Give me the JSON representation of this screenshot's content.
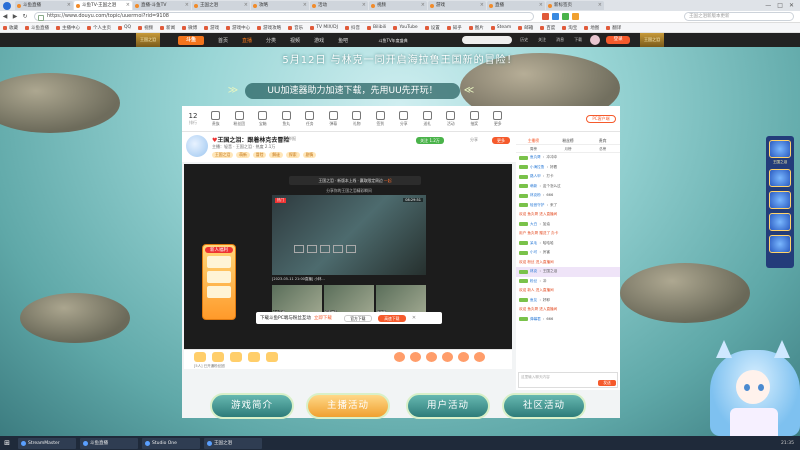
{
  "browser": {
    "tabs": [
      {
        "label": "斗鱼直播",
        "active": false
      },
      {
        "label": "斗鱼TV-王国之泪",
        "active": true
      },
      {
        "label": "直播-斗鱼TV",
        "active": false
      },
      {
        "label": "王国之泪",
        "active": false
      },
      {
        "label": "攻略",
        "active": false
      },
      {
        "label": "活动",
        "active": false
      },
      {
        "label": "视频",
        "active": false
      },
      {
        "label": "游戏",
        "active": false
      },
      {
        "label": "直播",
        "active": false
      },
      {
        "label": "新标签页",
        "active": false
      }
    ],
    "url": "https://www.douyu.com/topic/uuerrnoi?rid=9108",
    "search_placeholder": "王国之泪新版本更新",
    "bookmarks": [
      "收藏",
      "斗鱼直播",
      "主播中心",
      "个人主页",
      "QQ",
      "视频",
      "新闻",
      "微博",
      "游戏",
      "游戏中心",
      "游戏攻略",
      "音乐",
      "TV MIX/DJ",
      "抖音",
      "Bilibili",
      "YouTube",
      "设置",
      "知乎",
      "图片",
      "Steam",
      "邮箱",
      "百度",
      "淘宝",
      "地图",
      "翻译"
    ],
    "window_controls": [
      "—",
      "□",
      "✕"
    ]
  },
  "site": {
    "logo": "斗鱼",
    "nav": [
      "首页",
      "直播",
      "分类",
      "视频",
      "游戏",
      "鱼吧"
    ],
    "header_center": "斗鱼TV年度盛典",
    "header_icons": [
      "历史",
      "关注",
      "消息",
      "下载"
    ],
    "login": "登录",
    "side_badge": "王国之泪",
    "banner_title": "5月12日 与林克一同开启海拉鲁王国新的冒险！",
    "banner_sub": "UU加速器助力加速下载，先用UU先开玩！",
    "banner_arrow_left": "≫",
    "banner_arrow_right": "≪"
  },
  "room": {
    "rank_num": "12",
    "rank_label": "排行",
    "tools": [
      "贵族",
      "粉丝团",
      "宝箱",
      "鱼丸",
      "任务",
      "弹幕",
      "礼物",
      "签到",
      "分享",
      "送礼",
      "活动",
      "抽奖",
      "更多"
    ],
    "pc_button": "PC客户端",
    "title": "王国之泪：跟着林克去冒险",
    "report": "举报",
    "meta": "主播：轻音 · 王国之泪 · 热度 2.1万",
    "tags": [
      "王国之泪",
      "萌新",
      "冒险",
      "解谜",
      "探索",
      "剧情"
    ],
    "follow": "关注 1.2万",
    "share": "分享",
    "more": "更多"
  },
  "player": {
    "event_bar": "王国之泪 · 新版本上线 · 赢取限定周边",
    "event_highlight": "一起",
    "sub_title": "分享你的王国之泪精彩瞬间",
    "video_tag": "热门",
    "video_time": "08:29:51",
    "video_caption": "[2023-05-11 21:00直播] 小林...",
    "thumbs": [
      "左右互搏",
      "探索神庙",
      "新技能"
    ],
    "promo_header": "新人福利",
    "download_text": "下载斗鱼PC端与粉丝互动",
    "download_link": "立即下载",
    "download_btn1": "官方下载",
    "download_btn2": "高速下载",
    "close": "✕",
    "gift_note": "[5人] 已开通粉丝团"
  },
  "chat": {
    "tabs": [
      "主播榜",
      "粉丝榜",
      "贵宾"
    ],
    "active_tab": 0,
    "sub_tabs": [
      "周榜",
      "月榜",
      "总榜"
    ],
    "messages": [
      {
        "lv": "LV8",
        "name": "鱼丸哥",
        "text": "：冲冲冲",
        "type": "normal"
      },
      {
        "lv": "LV5",
        "name": "小海拉鲁",
        "text": "：好看",
        "type": "normal"
      },
      {
        "lv": "LV12",
        "name": "路人甲",
        "text": "：打卡",
        "type": "normal"
      },
      {
        "lv": "LV3",
        "name": "萌新",
        "text": "：这个怎么过",
        "type": "normal"
      },
      {
        "lv": "LV6",
        "name": "林克粉",
        "text": "：666",
        "type": "normal"
      },
      {
        "lv": "LV9",
        "name": "轻音守护",
        "text": "：来了",
        "type": "normal"
      },
      {
        "lv": "",
        "name": "",
        "text": "欢迎 鱼丸哥 进入直播间",
        "type": "sys"
      },
      {
        "lv": "LV4",
        "name": "大白",
        "text": "：加油",
        "type": "normal"
      },
      {
        "lv": "",
        "name": "",
        "text": "用户 鱼丸哥 赠送了 办卡",
        "type": "sys"
      },
      {
        "lv": "LV7",
        "name": "呆毛",
        "text": "：哈哈哈",
        "type": "normal"
      },
      {
        "lv": "LV2",
        "name": "小可",
        "text": "：厉害",
        "type": "normal"
      },
      {
        "lv": "",
        "name": "",
        "text": "欢迎 粉丝 进入直播间",
        "type": "sys"
      },
      {
        "lv": "LV10",
        "name": "林克",
        "text": "：王国之泪",
        "type": "hl"
      },
      {
        "lv": "LV5",
        "name": "粉丝",
        "text": "：冲",
        "type": "normal"
      },
      {
        "lv": "",
        "name": "",
        "text": "欢迎 新人 进入直播间",
        "type": "sys"
      },
      {
        "lv": "LV3",
        "name": "鱼友",
        "text": "：好耶",
        "type": "normal"
      },
      {
        "lv": "",
        "name": "",
        "text": "欢迎 鱼丸哥 进入直播间",
        "type": "sys"
      },
      {
        "lv": "LV6",
        "name": "弹幕君",
        "text": "：666",
        "type": "normal"
      }
    ],
    "input_placeholder": "这里输入聊天内容",
    "send": "发送"
  },
  "bottom_buttons": [
    {
      "label": "游戏简介",
      "active": false
    },
    {
      "label": "主播活动",
      "active": true
    },
    {
      "label": "用户活动",
      "active": false
    },
    {
      "label": "社区活动",
      "active": false
    }
  ],
  "side_panel": {
    "caption": "王国之泪"
  },
  "taskbar": {
    "start": "⊞",
    "tasks": [
      "StreamMaster",
      "斗鱼直播",
      "Studio One",
      "王国之泪"
    ],
    "tray": "21:35"
  },
  "colors": {
    "accent": "#f55a2c",
    "banner": "#9ad6d6",
    "active_button": "#f0a030"
  }
}
